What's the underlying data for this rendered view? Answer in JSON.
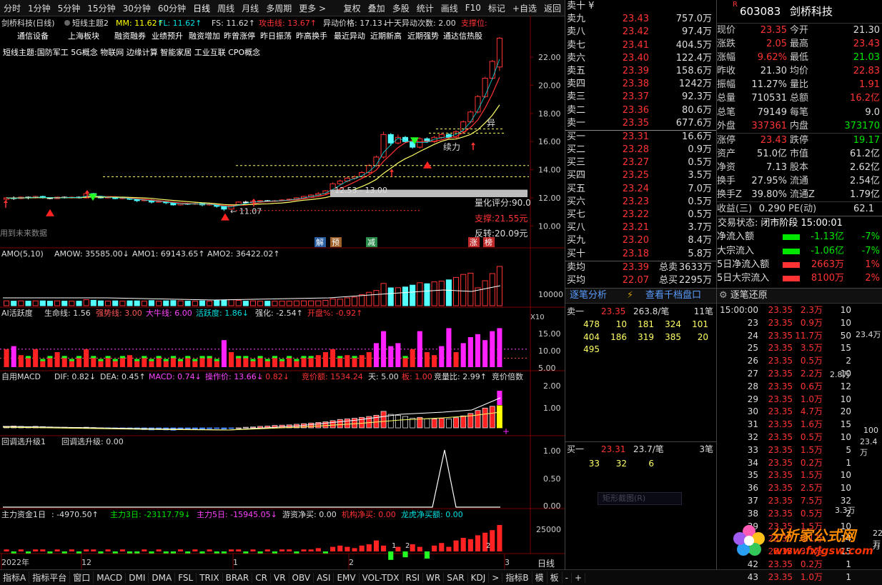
{
  "toolbar": {
    "left_tabs": [
      "分时",
      "1分钟",
      "5分钟",
      "15分钟",
      "30分钟",
      "60分钟",
      "日线",
      "周线",
      "月线",
      "多周期",
      "更多 >"
    ],
    "right_tabs": [
      "复权",
      "叠加",
      "多股",
      "统计",
      "画线",
      "F10",
      "标记",
      "+自选",
      "返回"
    ],
    "active": "日线"
  },
  "main_chart": {
    "title": "剑桥科技(日线)",
    "indicator_name": "短线主题2",
    "mm": "MM: 11.62↑",
    "fl": "FL: 11.62↑",
    "fs": "FS: 11.62↑",
    "attack": "攻击线: 13.67↑",
    "abnormal_price": "异动价格: 17.13↓",
    "ten_day": "十天异动次数: 2.00",
    "support": "支撑位:",
    "themes_row1": [
      "通信设备",
      "上海板块",
      "融资融券",
      "业绩预升",
      "融资增加",
      "昨曾涨停",
      "昨日振荡",
      "昨高换手",
      "最近异动",
      "近期新高",
      "近期强势",
      "通达信热股"
    ],
    "themes_row2": "短线主题:国防军工 5G概念 物联网 边缘计算 智能家居 工业互联 CPO概念",
    "y_ticks": [
      "22.00",
      "20.00",
      "18.00",
      "16.00",
      "14.00",
      "12.00",
      "10.00"
    ],
    "label_yi": "异",
    "label_xuli": "续力",
    "label_range": "12.53 - 13.00",
    "label_low": "← 11.07",
    "quant_score": "量化评分:90.0",
    "support_price": "支撑:21.55元",
    "reversal_price": "反转:20.09元",
    "future_note": "用到未来数据",
    "badges": [
      "解",
      "预",
      "减",
      "涨",
      "榜"
    ]
  },
  "amo_panel": {
    "title": "AMO(5,10)",
    "amow": "AMOW: 35585.00↓",
    "amo1": "AMO1: 69143.65↑",
    "amo2": "AMO2: 36422.02↑",
    "tick": "10000",
    "x10": "X10"
  },
  "ai_panel": {
    "title": "AI活跃度",
    "life": "生命线: 1.56",
    "strong": "强势线: 3.00",
    "bull": "大牛线: 6.00",
    "active": "活跃度: 1.86↓",
    "qiang": "强化: -2.54↑",
    "open_pct": "开盘%: -0.92↑",
    "ticks": [
      "15.00",
      "10.00",
      "5.00"
    ]
  },
  "macd_panel": {
    "title": "自用MACD",
    "dif": "DIF: 0.82↓",
    "dea": "DEA: 0.45↑",
    "macd": "MACD: 0.74↓",
    "op": "操作价: 13.66↓",
    "x": ": 0.82↓",
    "bid_amt": "竞价额: 1534.24",
    "day": "天: 5.00",
    "board": "板: 1.00",
    "ratio": "竞量比: 2.99↑",
    "mult": "竞价倍数",
    "ticks": [
      "2.00",
      "1.00"
    ]
  },
  "pullback_panel": {
    "title": "回调选升级1",
    "sub": "回调选升级: 0.00",
    "ticks": [
      "1.00",
      "0.50",
      "0.00"
    ]
  },
  "fund_panel": {
    "title": "主力资金1日",
    "d1": ": -4970.50↑",
    "d3": "主力3日: -23117.79↓",
    "d5": "主力5日: -15945.05↓",
    "hot": "游资净买: 0.00",
    "inst": "机构净买: 0.00",
    "dragon": "龙虎净买额: 0.00",
    "tick": "25000",
    "marks": [
      "1",
      "2",
      "2"
    ]
  },
  "x_axis": {
    "labels": [
      "2022年",
      "12",
      "1",
      "2",
      "3"
    ],
    "period": "日线"
  },
  "bottom_tabs": [
    "指标A",
    "指标平台",
    "窗口",
    "MACD",
    "DMI",
    "DMA",
    "FSL",
    "TRIX",
    "BRAR",
    "CR",
    "VR",
    "OBV",
    "ASI",
    "EMV",
    "VOL-TDX",
    "RSI",
    "WR",
    "SAR",
    "KDJ",
    ">",
    "指标B",
    "模",
    "板",
    "-",
    "+"
  ],
  "orderbook": {
    "header": "卖十 ¥",
    "asks": [
      {
        "label": "卖九",
        "price": "23.43",
        "vol": "757.0万"
      },
      {
        "label": "卖八",
        "price": "23.42",
        "vol": "97.4万"
      },
      {
        "label": "卖七",
        "price": "23.41",
        "vol": "404.5万"
      },
      {
        "label": "卖六",
        "price": "23.40",
        "vol": "122.4万"
      },
      {
        "label": "卖五",
        "price": "23.39",
        "vol": "158.6万"
      },
      {
        "label": "卖四",
        "price": "23.38",
        "vol": "1242万"
      },
      {
        "label": "卖三",
        "price": "23.37",
        "vol": "92.3万"
      },
      {
        "label": "卖二",
        "price": "23.36",
        "vol": "80.6万"
      },
      {
        "label": "卖一",
        "price": "23.35",
        "vol": "677.6万"
      }
    ],
    "bids": [
      {
        "label": "买一",
        "price": "23.31",
        "vol": "16.6万"
      },
      {
        "label": "买二",
        "price": "23.28",
        "vol": "0.9万"
      },
      {
        "label": "买三",
        "price": "23.27",
        "vol": "0.5万"
      },
      {
        "label": "买四",
        "price": "23.25",
        "vol": "3.5万"
      },
      {
        "label": "买五",
        "price": "23.24",
        "vol": "7.0万"
      },
      {
        "label": "买六",
        "price": "23.23",
        "vol": "0.5万"
      },
      {
        "label": "买七",
        "price": "23.22",
        "vol": "0.5万"
      },
      {
        "label": "买八",
        "price": "23.21",
        "vol": "3.7万"
      },
      {
        "label": "买九",
        "price": "23.20",
        "vol": "8.4万"
      },
      {
        "label": "买十",
        "price": "23.18",
        "vol": "5.8万"
      }
    ],
    "avg_sell_label": "卖均",
    "avg_sell": "23.39",
    "total_sell_label": "总卖",
    "total_sell": "3633万",
    "avg_buy_label": "买均",
    "avg_buy": "22.07",
    "total_buy_label": "总买",
    "total_buy": "2295万"
  },
  "quote": {
    "code": "603083",
    "name": "剑桥科技",
    "rows": [
      [
        "现价",
        "23.35",
        "今开",
        "21.30"
      ],
      [
        "涨跌",
        "2.05",
        "最高",
        "23.43"
      ],
      [
        "涨幅",
        "9.62%",
        "最低",
        "21.03"
      ],
      [
        "昨收",
        "21.30",
        "均价",
        "22.83"
      ],
      [
        "振幅",
        "11.27%",
        "量比",
        "1.91"
      ],
      [
        "总量",
        "710531",
        "总额",
        "16.2亿"
      ],
      [
        "总笔",
        "79149",
        "每笔",
        "9.0"
      ],
      [
        "外盘",
        "337361",
        "内盘",
        "373170"
      ],
      [
        "涨停",
        "23.43",
        "跌停",
        "19.17"
      ],
      [
        "资产",
        "51.0亿",
        "市值",
        "61.2亿"
      ],
      [
        "净资",
        "7.13",
        "股本",
        "2.62亿"
      ],
      [
        "换手",
        "27.95%",
        "流通",
        "2.54亿"
      ],
      [
        "换手Z",
        "39.80%",
        "流通Z",
        "1.79亿"
      ],
      [
        "收益(三)",
        "0.290",
        "PE(动)",
        "62.1"
      ]
    ],
    "status_label": "交易状态:",
    "status": "闭市阶段 15:00:01",
    "flows": [
      {
        "label": "净流入额",
        "value": "-1.13亿",
        "pct": "-7%",
        "color": "#00e600"
      },
      {
        "label": "大宗流入",
        "value": "-1.06亿",
        "pct": "-7%",
        "color": "#00e600"
      },
      {
        "label": "5日净流入额",
        "value": "2663万",
        "pct": "1%",
        "color": "#ff3333"
      },
      {
        "label": "5日大宗流入",
        "value": "8100万",
        "pct": "2%",
        "color": "#ff3333"
      }
    ]
  },
  "tick_analysis": {
    "tab1": "逐笔分析",
    "tab2": "查看千档盘口",
    "sell_row": {
      "label": "卖一",
      "price": "23.35",
      "qty": "263.8/笔",
      "count": "11笔"
    },
    "sell_grid": [
      [
        "478",
        "10",
        "181",
        "324",
        "101"
      ],
      [
        "404",
        "186",
        "319",
        "385",
        "20"
      ],
      [
        "495",
        "",
        "",
        "",
        ""
      ]
    ],
    "buy_row": {
      "label": "买一",
      "price": "23.31",
      "qty": "23.7/笔",
      "count": "3笔"
    },
    "buy_grid": [
      [
        "33",
        "32",
        "6",
        "",
        ""
      ]
    ],
    "watermark": "矩形截图(R)"
  },
  "trades": {
    "title": "逐笔还原",
    "rows": [
      [
        "15:00:00",
        "23.35",
        "2.3万",
        "10"
      ],
      [
        "23",
        "23.35",
        "0.9万",
        "10"
      ],
      [
        "24",
        "23.35",
        "11.7万",
        "50"
      ],
      [
        "25",
        "23.35",
        "3.5万",
        "15"
      ],
      [
        "26",
        "23.35",
        "0.5万",
        "2"
      ],
      [
        "27",
        "23.35",
        "2.2万",
        "10"
      ],
      [
        "28",
        "23.35",
        "0.6万",
        "12"
      ],
      [
        "29",
        "23.35",
        "1.0万",
        "10"
      ],
      [
        "30",
        "23.35",
        "4.7万",
        "20"
      ],
      [
        "31",
        "23.35",
        "1.6万",
        "15"
      ],
      [
        "32",
        "23.35",
        "0.5万",
        "10"
      ],
      [
        "33",
        "23.35",
        "1.5万",
        "5"
      ],
      [
        "34",
        "23.35",
        "0.2万",
        "1"
      ],
      [
        "35",
        "23.35",
        "1.5万",
        "10"
      ],
      [
        "36",
        "23.35",
        "2.5万",
        "10"
      ],
      [
        "37",
        "23.35",
        "7.5万",
        "32"
      ],
      [
        "38",
        "23.35",
        "0.5万",
        "2"
      ],
      [
        "39",
        "23.35",
        "1.5万",
        "10"
      ],
      [
        "40",
        "23.35",
        "0.1万",
        "14"
      ],
      [
        "41",
        "23.35",
        "3.1万",
        "15"
      ],
      [
        "42",
        "23.35",
        "0.2万",
        "1"
      ],
      [
        "43",
        "23.35",
        "1.0万",
        "1"
      ]
    ],
    "side_values": [
      "23.4万",
      "2.8万",
      "100",
      "23.4万",
      "3.3万",
      "22万",
      "万"
    ]
  },
  "watermark": {
    "cn": "分析家公式网",
    "url": "www.fxjgsw.com"
  }
}
